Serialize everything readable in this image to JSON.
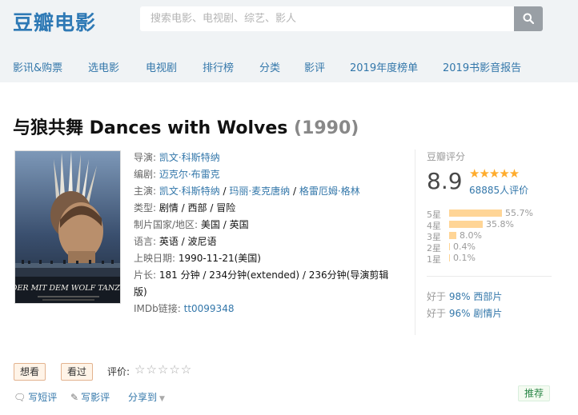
{
  "header": {
    "logo": "豆瓣电影",
    "search_placeholder": "搜索电影、电视剧、综艺、影人"
  },
  "nav": [
    "影讯&购票",
    "选电影",
    "电视剧",
    "排行榜",
    "分类",
    "影评",
    "2019年度榜单",
    "2019书影音报告"
  ],
  "movie": {
    "title": "与狼共舞 Dances with Wolves",
    "year": "(1990)",
    "poster_text": "DER MIT DEM WOLF TANZT"
  },
  "info": {
    "director_label": "导演: ",
    "director": "凯文·科斯特纳",
    "writer_label": "编剧: ",
    "writer": "迈克尔·布雷克",
    "cast_label": "主演: ",
    "cast": [
      "凯文·科斯特纳",
      "玛丽·麦克唐纳",
      "格雷厄姆·格林"
    ],
    "sep": " / ",
    "genre_label": "类型: ",
    "genre": "剧情 / 西部 / 冒险",
    "country_label": "制片国家/地区: ",
    "country": "美国 / 英国",
    "language_label": "语言: ",
    "language": "英语 / 波尼语",
    "release_label": "上映日期: ",
    "release": "1990-11-21(美国)",
    "runtime_label": "片长: ",
    "runtime": "181 分钟 / 234分钟(extended) / 236分钟(导演剪辑版)",
    "imdb_label": "IMDb链接: ",
    "imdb": "tt0099348"
  },
  "rating": {
    "label": "豆瓣评分",
    "score": "8.9",
    "stars": "★★★★★",
    "count": "68885人评价",
    "bars": [
      {
        "label": "5星",
        "pct": "55.7%",
        "value": 55.7
      },
      {
        "label": "4星",
        "pct": "35.8%",
        "value": 35.8
      },
      {
        "label": "3星",
        "pct": "8.0%",
        "value": 8.0
      },
      {
        "label": "2星",
        "pct": "0.4%",
        "value": 0.4
      },
      {
        "label": "1星",
        "pct": "0.1%",
        "value": 0.1
      }
    ],
    "better_than": [
      {
        "prefix": "好于 ",
        "link": "98% 西部片"
      },
      {
        "prefix": "好于 ",
        "link": "96% 剧情片"
      }
    ]
  },
  "actions": {
    "want_to_see": "想看",
    "seen": "看过",
    "rate_label": "评价:",
    "rate_stars": "☆☆☆☆☆",
    "write_short": "写短评",
    "write_review": "写影评",
    "share": "分享到",
    "recommend": "推荐"
  },
  "colors": {
    "brand": "#2e79b5",
    "link": "#37a",
    "star": "#ffac2d",
    "bar": "#ffd596"
  }
}
